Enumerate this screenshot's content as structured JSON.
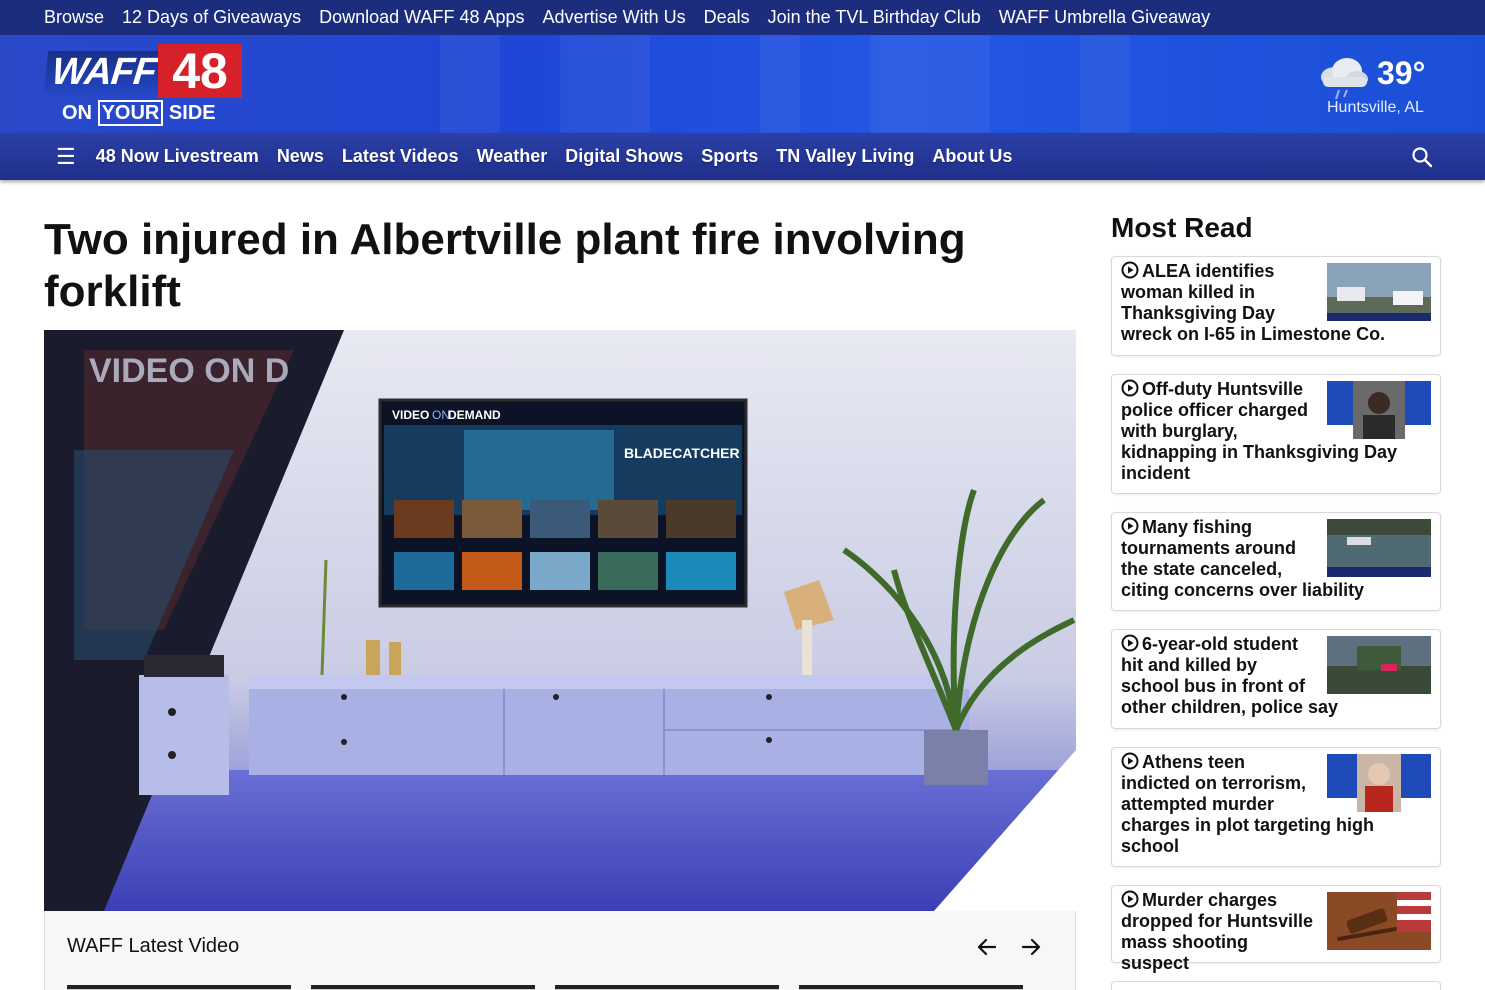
{
  "topbar": {
    "links": [
      "Browse",
      "12 Days of Giveaways",
      "Download WAFF 48 Apps",
      "Advertise With Us",
      "Deals",
      "Join the TVL Birthday Club",
      "WAFF Umbrella Giveaway"
    ]
  },
  "header": {
    "logo_text": "WAFF",
    "logo_number": "48",
    "logo_tagline_1": "ON",
    "logo_tagline_2": "YOUR",
    "logo_tagline_3": "SIDE",
    "weather_temp": "39°",
    "weather_location": "Huntsville, AL",
    "weather_icon": "rain-cloud-icon"
  },
  "nav": {
    "menu_icon": "hamburger-icon",
    "items": [
      "48 Now Livestream",
      "News",
      "Latest Videos",
      "Weather",
      "Digital Shows",
      "Sports",
      "TN Valley Living",
      "About Us"
    ],
    "search_icon": "search-icon"
  },
  "article": {
    "headline": "Two injured in Albertville plant fire involving forklift",
    "video": {
      "tv_label_1": "VIDEO",
      "tv_label_2": "ON",
      "tv_label_3": "DEMAND",
      "tv_show": "BLADECATCHER",
      "watermark": "VIDEO ON D"
    }
  },
  "latest_video": {
    "title": "WAFF Latest Video"
  },
  "most_read": {
    "title": "Most Read",
    "items": [
      {
        "headline": "ALEA identifies woman killed in Thanksgiving Day wreck on I-65 in Limestone Co."
      },
      {
        "headline": "Off-duty Huntsville police officer charged with burglary, kidnapping in Thanksgiving Day incident"
      },
      {
        "headline": "Many fishing tournaments around the state canceled, citing concerns over liability"
      },
      {
        "headline": "6-year-old student hit and killed by school bus in front of other children, police say"
      },
      {
        "headline": "Athens teen indicted on terrorism, attempted murder charges in plot targeting high school"
      },
      {
        "headline": "Murder charges dropped for Huntsville mass shooting suspect"
      }
    ]
  },
  "colors": {
    "topbar": "#1c2d7e",
    "header": "#2357e4",
    "nav": "#24358f",
    "logo_red": "#d6202a"
  }
}
